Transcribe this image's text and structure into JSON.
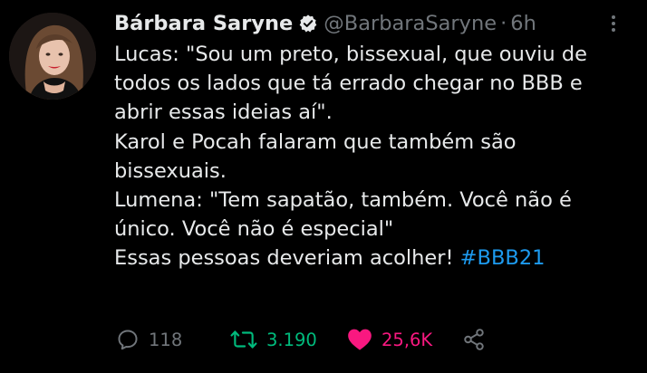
{
  "tweet": {
    "author": {
      "display_name": "Bárbara Saryne",
      "handle": "@BarbaraSaryne",
      "verified": true,
      "separator": "·",
      "timestamp": "6h"
    },
    "body": {
      "lines": [
        "Lucas: \"Sou um preto, bissexual, que ouviu de",
        "todos os lados que tá errado chegar no BBB e",
        "abrir essas ideias aí\".",
        "Karol e Pocah falaram que também são",
        "bissexuais.",
        "Lumena: \"Tem sapatão, também. Você não é",
        "único. Você não é especial\""
      ],
      "last_line_text": "Essas pessoas deveriam acolher! ",
      "hashtag": "#BBB21"
    },
    "actions": {
      "reply": {
        "icon": "reply-icon",
        "count": "118"
      },
      "retweet": {
        "icon": "retweet-icon",
        "count": "3.190"
      },
      "like": {
        "icon": "heart-icon",
        "count": "25,6K"
      },
      "share": {
        "icon": "share-icon"
      }
    }
  },
  "colors": {
    "background": "#000000",
    "text": "#e7e9ea",
    "muted": "#71767b",
    "link": "#1d9bf0",
    "retweet": "#00ba7c",
    "like": "#f91880"
  }
}
